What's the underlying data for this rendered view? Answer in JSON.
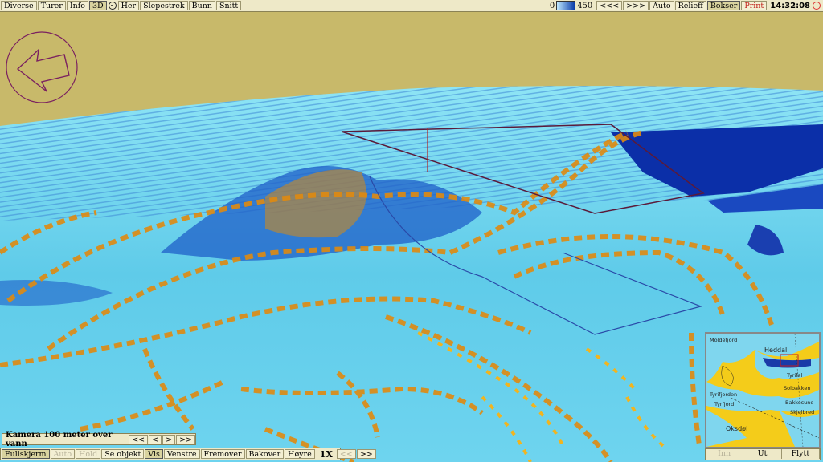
{
  "toolbar": {
    "items": [
      "Diverse",
      "Turer",
      "Info",
      "3D"
    ],
    "after_icon": [
      "Her",
      "Slepestrek",
      "Bunn",
      "Snitt"
    ],
    "depth_min": "0",
    "depth_max": "450",
    "right_items": [
      "<<<",
      ">>>",
      "Auto",
      "Relieff",
      "Bokser",
      "Print"
    ],
    "time": "14:32:08"
  },
  "camera": {
    "label": "Kamera 100 meter over vann",
    "buttons": [
      "<<",
      "<",
      ">",
      ">>"
    ]
  },
  "bottom_bar": {
    "items": [
      "Fullskjerm",
      "Auto",
      "Hold",
      "Se objekt",
      "Vis",
      "Venstre",
      "Fremover",
      "Bakover",
      "Høyre"
    ],
    "speed": "1X",
    "speed_buttons": [
      "<<",
      ">>"
    ]
  },
  "minimap": {
    "labels": [
      "Moldefjord",
      "Heddal",
      "Tyrifjorden",
      "Tyrifal",
      "Tyrfjord",
      "Solbakken",
      "Oksdøl",
      "Bakkesund",
      "Skjelbred"
    ],
    "buttons": [
      "Inn",
      "Ut",
      "Flytt"
    ]
  },
  "colors": {
    "sky": "#c8b96a",
    "water_light": "#6fd6f0",
    "water_deep": "#0b2fa8",
    "contour": "#e08a10",
    "land": "#f4cc1a"
  },
  "icons": [
    "compass-icon",
    "target-icon",
    "back-arrow-icon"
  ]
}
